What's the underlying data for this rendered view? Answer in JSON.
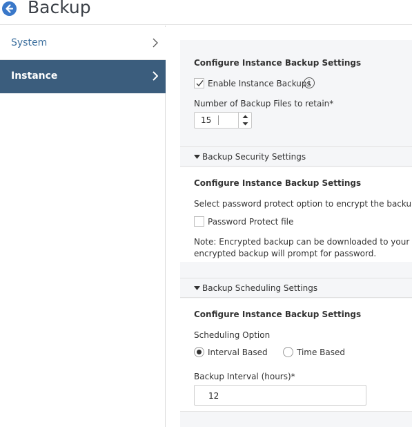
{
  "header": {
    "title": "Backup"
  },
  "sidebar": {
    "items": [
      {
        "label": "System"
      },
      {
        "label": "Instance"
      }
    ]
  },
  "main": {
    "instance_backup": {
      "title": "Configure Instance Backup Settings",
      "enable_label": "Enable Instance Backups",
      "enable_checked": true,
      "retain_label": "Number of Backup Files to retain*",
      "retain_value": "15"
    },
    "security": {
      "header": "Backup Security Settings",
      "title": "Configure Instance Backup Settings",
      "description": "Select password protect option to encrypt the backup file.",
      "password_label": "Password Protect file",
      "password_checked": false,
      "note_line1": "Note: Encrypted backup can be downloaded to your local m",
      "note_line2": "encrypted backup will prompt for password."
    },
    "scheduling": {
      "header": "Backup Scheduling Settings",
      "title": "Configure Instance Backup Settings",
      "option_label": "Scheduling Option",
      "options": [
        "Interval Based",
        "Time Based"
      ],
      "selected": "Interval Based",
      "interval_label": "Backup Interval (hours)*",
      "interval_value": "12"
    }
  }
}
